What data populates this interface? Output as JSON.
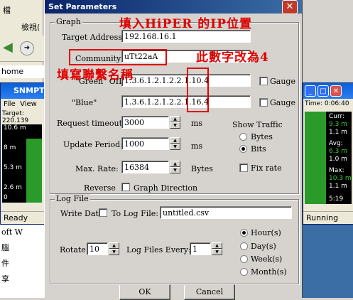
{
  "background": {
    "left_menu": "檔",
    "left_menu2": "檢視(",
    "address": "home",
    "left_window_title": "SNMPT",
    "left_menu_items": [
      "File",
      "View"
    ],
    "left_info": "Target: 220.139",
    "left_ticks": [
      "10.6 m",
      "8 m",
      "5.3 m",
      "2.6 m",
      "0"
    ],
    "left_status": "Ready",
    "left_lower": [
      "oft W",
      "腦",
      "件",
      "享"
    ],
    "right_time": "Time: 0:06:40",
    "right_stats": [
      "Curr:",
      "9.3 m",
      "1.1 m",
      "Avg:",
      "6.3 m",
      "1.0 m",
      "Max:",
      "10.3 m",
      "1.1 m"
    ],
    "right_clock": "5:19",
    "right_status": "Running"
  },
  "dialog": {
    "title": "Set Parameters",
    "close_glyph": "✕",
    "graph_group": "Graph",
    "target_label": "Target Address:",
    "target_value": "192.168.16.1",
    "community_label": "Community",
    "community_value": "uTt22aA",
    "green_oid_label": "\"Green\" OID:",
    "green_oid_value": "1.3.6.1.2.1.2.2.1.10.4",
    "blue_label": "\"Blue\"",
    "blue_oid_value": "1.3.6.1.2.1.2.2.1.16.4",
    "gauge_label": "Gauge",
    "request_timeout_label": "Request timeout:",
    "request_timeout_value": "3000",
    "update_period_label": "Update Period:",
    "update_period_value": "1000",
    "max_rate_label": "Max. Rate:",
    "max_rate_value": "16384",
    "ms_label": "ms",
    "bytes_label": "Bytes",
    "show_traffic_label": "Show Traffic",
    "bytes_option": "Bytes",
    "bits_option": "Bits",
    "fix_rate_label": "Fix rate",
    "reverse_label": "Reverse",
    "graph_direction_label": "Graph Direction",
    "log_group": "Log File",
    "write_data_label": "Write Data",
    "to_log_file_label": "To Log File:",
    "log_file_value": "untitled.csv",
    "rotate_label": "Rotate",
    "rotate_value": "10",
    "log_files_every_label": "Log Files  Every:",
    "every_value": "1",
    "hour_option": "Hour(s)",
    "day_option": "Day(s)",
    "week_option": "Week(s)",
    "month_option": "Month(s)",
    "ok_label": "OK",
    "cancel_label": "Cancel",
    "selected_traffic": "Bits",
    "selected_period": "Hour(s)"
  },
  "annotations": {
    "fill_hiper_ip": "填入HiPER 的IP位置",
    "change_digit": "此數字改為4",
    "fill_community": "填寫聯繫名稱",
    "color": "#e00000"
  }
}
